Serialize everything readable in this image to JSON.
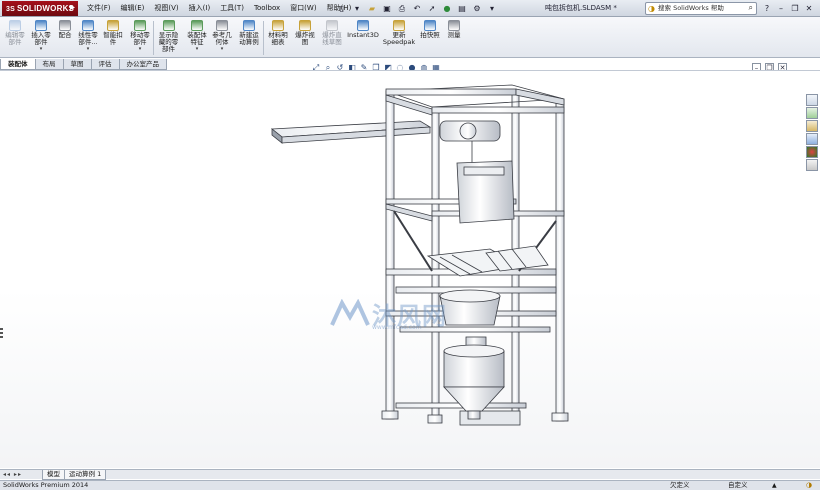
{
  "app": {
    "brand": "SOLIDWORKS",
    "brand_prefix": "3S",
    "document_title": "吨包拆包机.SLDASM *"
  },
  "menu": [
    "文件(F)",
    "编辑(E)",
    "视图(V)",
    "插入(I)",
    "工具(T)",
    "Toolbox",
    "窗口(W)",
    "帮助(H)"
  ],
  "help_search": {
    "placeholder": "搜索 SolidWorks 帮助"
  },
  "commands": [
    {
      "label": "编辑零\n部件",
      "disabled": true,
      "color": "#7aa0d0"
    },
    {
      "label": "插入零\n部件",
      "disabled": false,
      "color": "#4f86c6"
    },
    {
      "label": "配合",
      "disabled": false,
      "color": "#8a8f98"
    },
    {
      "label": "线性零\n部件...",
      "disabled": false,
      "color": "#4f86c6"
    },
    {
      "label": "智能扣\n件",
      "disabled": false,
      "color": "#c7a23a"
    },
    {
      "label": "移动零\n部件",
      "disabled": false,
      "color": "#5b9b5b"
    },
    {
      "label": "显示隐\n藏的零\n部件",
      "disabled": false,
      "color": "#5b9b5b"
    },
    {
      "label": "装配体\n特征",
      "disabled": false,
      "color": "#5b9b5b"
    },
    {
      "label": "参考几\n何体",
      "disabled": false,
      "color": "#8a8f98"
    },
    {
      "label": "新建运\n动算例",
      "disabled": false,
      "color": "#4f86c6"
    },
    {
      "label": "材料明\n细表",
      "disabled": false,
      "color": "#c7a23a"
    },
    {
      "label": "爆炸视\n图",
      "disabled": false,
      "color": "#c7a23a"
    },
    {
      "label": "爆炸直\n线草图",
      "disabled": true,
      "color": "#8a8f98"
    },
    {
      "label": "Instant3D",
      "disabled": false,
      "color": "#4f86c6"
    },
    {
      "label": "更新\nSpeedpak",
      "disabled": false,
      "color": "#c7a23a"
    },
    {
      "label": "拍快照",
      "disabled": false,
      "color": "#4f86c6"
    },
    {
      "label": "测量",
      "disabled": false,
      "color": "#8a8f98"
    }
  ],
  "tabs": [
    "装配体",
    "布局",
    "草图",
    "评估",
    "办公室产品"
  ],
  "active_tab": "装配体",
  "watermark": {
    "text": "沐风网",
    "url": "www.mfcad.com"
  },
  "bottom_tabs": [
    "模型",
    "运动算例 1"
  ],
  "status": {
    "product": "SolidWorks Premium 2014",
    "state": "欠定义",
    "units": "自定义"
  },
  "colors": {
    "brand": "#8c0d15",
    "accent": "#4f86c6"
  }
}
